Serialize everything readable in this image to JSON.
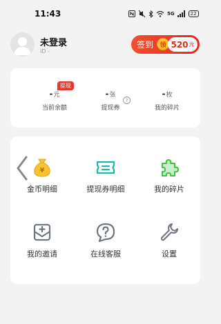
{
  "status_bar": {
    "time": "11:43",
    "network": "5G",
    "battery": "22"
  },
  "profile": {
    "name": "未登录",
    "id_text": "ID -"
  },
  "checkin": {
    "label": "签到",
    "badge": "领",
    "amount": "520",
    "unit": "元"
  },
  "stats": {
    "withdraw_tag": "提现",
    "items": [
      {
        "value": "-",
        "unit": "元",
        "label": "当前余额"
      },
      {
        "value": "-",
        "unit": "张",
        "label": "提现券"
      },
      {
        "value": "-",
        "unit": "枚",
        "label": "我的碎片"
      }
    ]
  },
  "menu": {
    "items": [
      {
        "label": "金币明细",
        "icon": "money-bag-icon"
      },
      {
        "label": "提现券明细",
        "icon": "ticket-icon"
      },
      {
        "label": "我的碎片",
        "icon": "puzzle-icon"
      },
      {
        "label": "我的邀请",
        "icon": "invite-icon"
      },
      {
        "label": "在线客服",
        "icon": "question-bubble-icon"
      },
      {
        "label": "设置",
        "icon": "wrench-icon"
      }
    ]
  },
  "colors": {
    "accent_red": "#e8251a",
    "gold": "#f8c230",
    "teal": "#20b5a8",
    "green": "#3cc23c",
    "gray_icon": "#6e7580"
  }
}
